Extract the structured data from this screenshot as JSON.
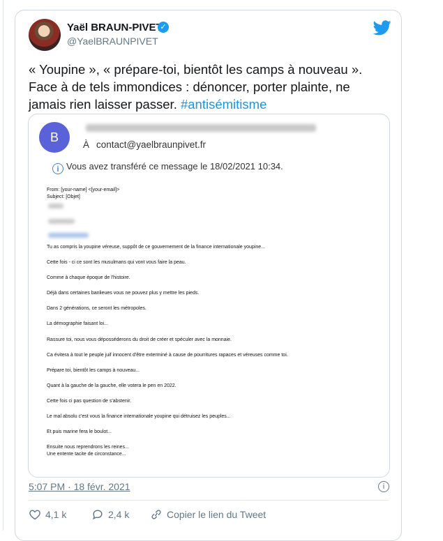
{
  "tweet": {
    "author_name": "Yaël BRAUN-PIVET",
    "handle": "@YaelBRAUNPIVET",
    "text_main": "« Youpine », « prépare-toi, bientôt les camps à nouveau ».\nFace à de tels immondices : dénoncer, porter plainte, ne jamais rien laisser passer. ",
    "hashtag": "#antisémitisme",
    "timestamp": "5:07 PM · 18 févr. 2021",
    "likes": "4,1 k",
    "comments": "2,4 k",
    "share_label": "Copier le lien du Tweet"
  },
  "email": {
    "sender_initial": "B",
    "to_label": "À",
    "to_address": "contact@yaelbraunpivet.fr",
    "forward_notice": "Vous avez transféré ce message le 18/02/2021 10:34.",
    "header_from": "From: [your-name] <[your-email]>",
    "header_subject": "Subject: [Objet]",
    "body_lines": [
      "Tu as compris la youpine véreuse, suppôt de ce gouvernement de la finance internationale youpine...",
      "Cette fois - ci ce sont les musulmans qui vont vous faire la peau.",
      "Comme à chaque époque de l'histoire.",
      "Déjà dans certaines banlieues vous ne pouvez plus y mettre les pieds.",
      "Dans 2 générations, ce seront les métropoles.",
      "La démographie faisant loi...",
      "Rassure toi, nous vous déposséderons du droit de créer et spéculer avec la monnaie.",
      "Ca évitera à tout le peuple juif innocent d'être exterminé à cause de pourritures rapaces et véreuses comme toi.",
      "Prépare toi, bientôt les camps à nouveau...",
      "Quant à la gauche de la gauche, elle votera le pen en 2022.",
      "Cette fois ci pas question de s'abstenir.",
      "Le mal absolu c'est vous la finance internationale youpine qui détruisez les peuples...",
      "Et puis marine fera le boulot...",
      "Ensuite nous reprendrons les reines...",
      "Une entente tacite de circonstance..."
    ]
  },
  "colors": {
    "accent": "#1b95e0",
    "verified": "#1d9bf0",
    "sender_avatar": "#5a62d9",
    "muted_text": "#657786"
  },
  "icons": {
    "brand": "twitter-bird-icon",
    "verified": "verified-badge-icon",
    "info": "info-icon",
    "like": "heart-icon",
    "reply": "comment-icon",
    "share": "link-icon"
  }
}
